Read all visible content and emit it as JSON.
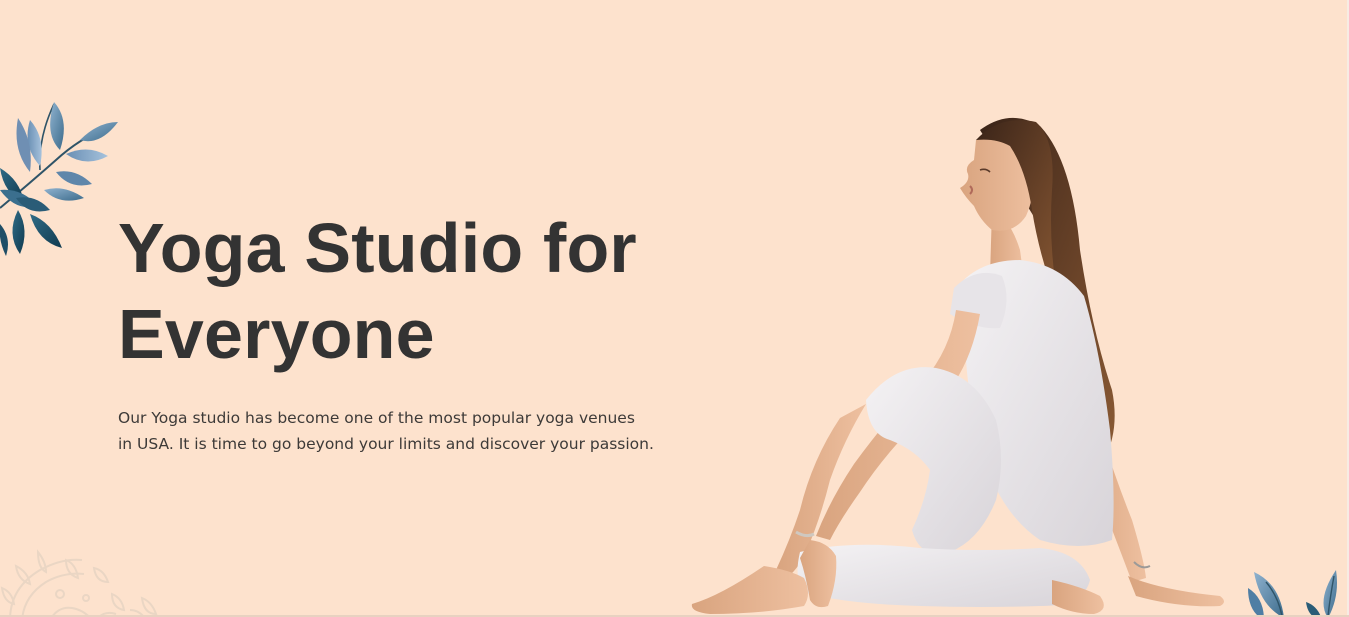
{
  "hero": {
    "headline_line1": "Yoga Studio for",
    "headline_line2": "Everyone",
    "description_line1": "Our Yoga studio has become one of the most popular yoga venues",
    "description_line2": "in USA. It is time to go beyond your limits and discover your passion.",
    "colors": {
      "background": "#fde2cd",
      "headline": "#333333",
      "body_text": "#3d3a38",
      "leaf_dark": "#1f4e66",
      "leaf_light": "#7fa6c4"
    },
    "decorations": {
      "top_left": "leaf-branch-icon",
      "bottom_right": "leaf-branch-icon",
      "bottom_left": "mandala-icon",
      "hero_image": "woman-yoga-twist-pose"
    }
  }
}
